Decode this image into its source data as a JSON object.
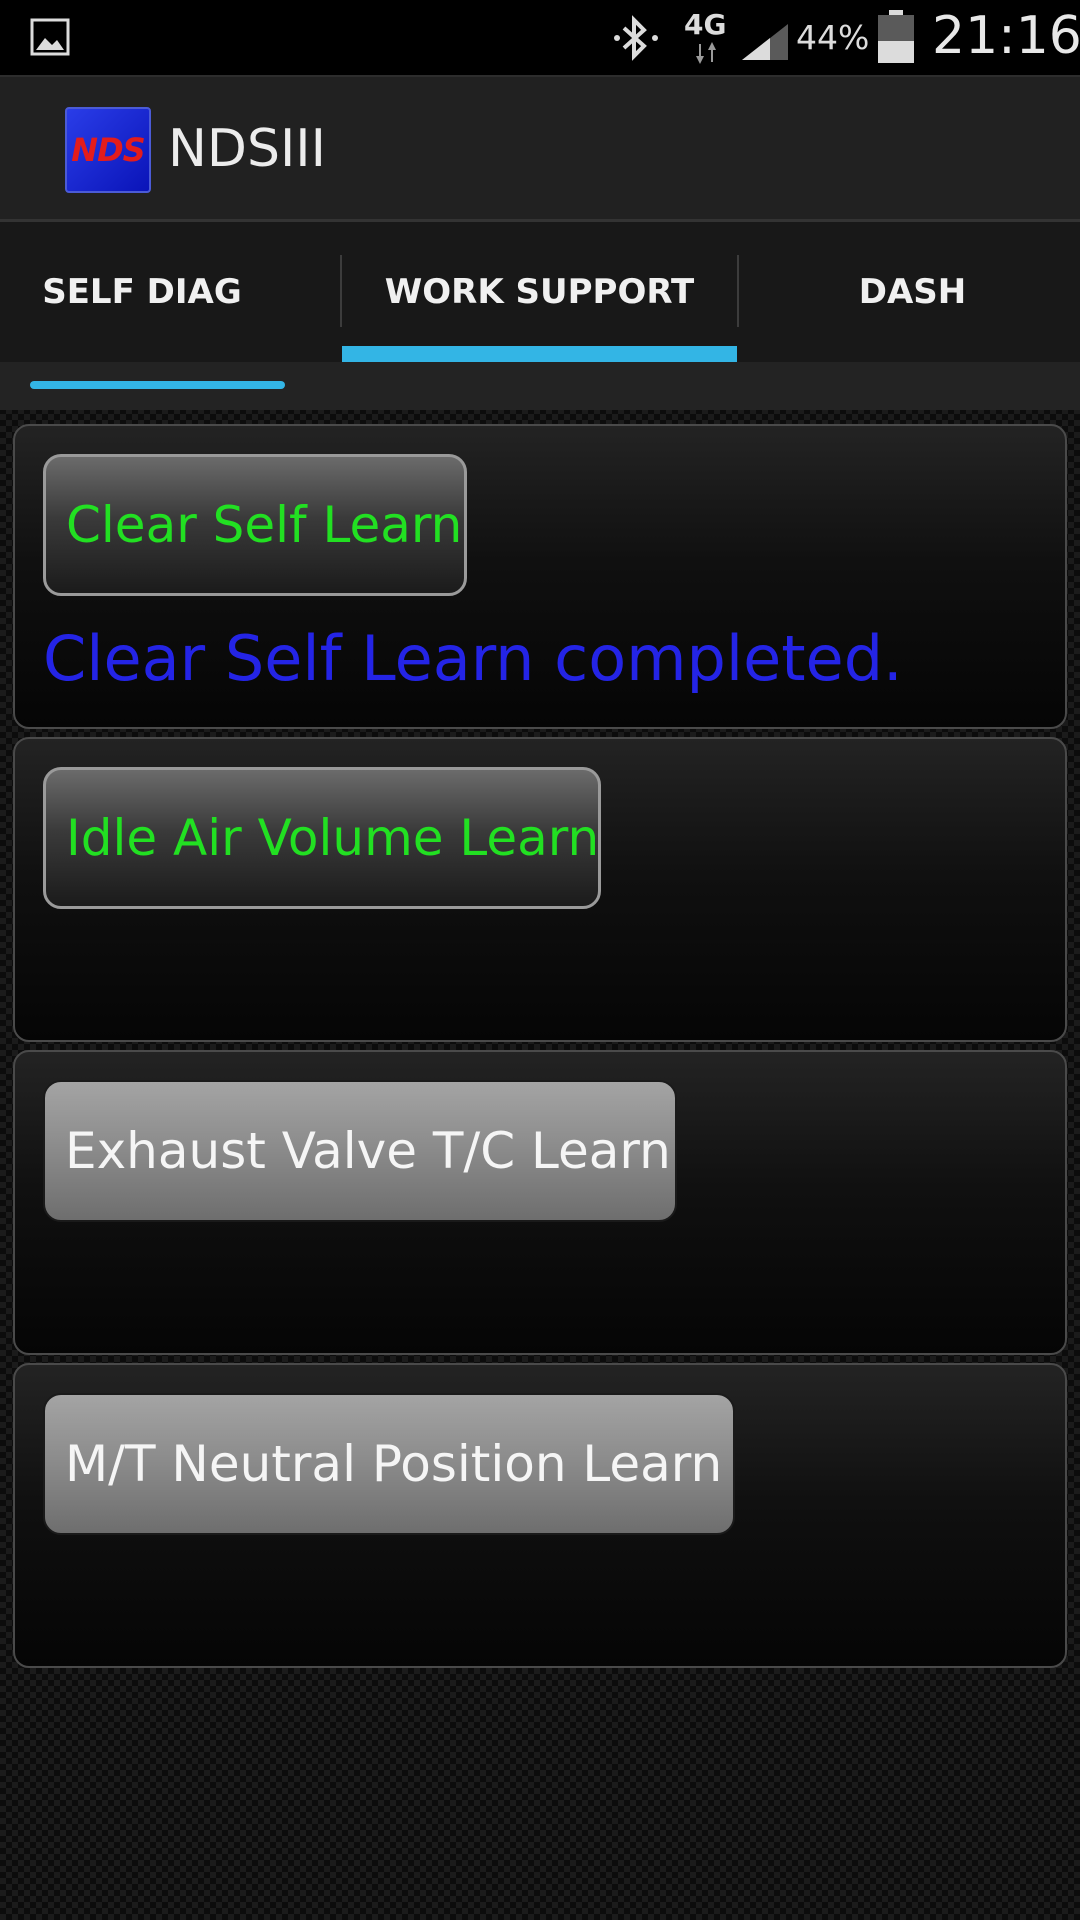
{
  "status_bar": {
    "network": "4G",
    "battery_percent": "44%",
    "time": "21:16",
    "icons": [
      "gallery-icon",
      "bluetooth-icon",
      "data-arrows-icon",
      "signal-icon",
      "battery-icon"
    ]
  },
  "app": {
    "title": "NDSIII",
    "logo_text": "NDS"
  },
  "tabs": [
    {
      "label": "SELF DIAG",
      "selected": false
    },
    {
      "label": "WORK SUPPORT",
      "selected": true
    },
    {
      "label": "DASH",
      "selected": false
    }
  ],
  "panels": [
    {
      "button_label": "Clear Self Learn",
      "button_style": "dark",
      "result": "Clear Self Learn completed."
    },
    {
      "button_label": "Idle Air Volume Learn",
      "button_style": "dark",
      "result": ""
    },
    {
      "button_label": "Exhaust Valve T/C Learn",
      "button_style": "light",
      "result": ""
    },
    {
      "button_label": "M/T Neutral Position Learn",
      "button_style": "light",
      "result": ""
    }
  ],
  "colors": {
    "accent": "#33b5e5",
    "button_green_text": "#22e022",
    "result_blue_text": "#2424e6"
  }
}
